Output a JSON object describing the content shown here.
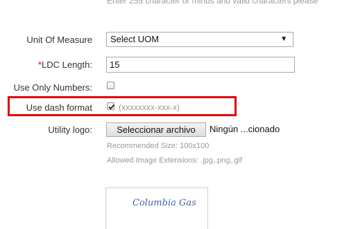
{
  "top_hint": "Enter 255 character or minus and valid characters please",
  "uom": {
    "label": "Unit Of Measure",
    "selected": "Select UOM"
  },
  "ldc_length": {
    "required_mark": "*",
    "label": "LDC Length:",
    "value": "15"
  },
  "only_numbers": {
    "label": "Use Only Numbers:",
    "checked": false
  },
  "dash_format": {
    "label": "Use dash format",
    "checked": true,
    "hint": "(xxxxxxxx-xxx-x)",
    "highlight_color": "#e00000"
  },
  "utility_logo": {
    "label": "Utility logo:",
    "button_label": "Seleccionar archivo",
    "file_status": "Ningún ...cionado",
    "recommended_size": "Recommended Size: 100x100",
    "allowed_extensions": "Allowed Image Extensions: .jpg,.png,.gif",
    "preview_text": "Columbia Gas"
  }
}
